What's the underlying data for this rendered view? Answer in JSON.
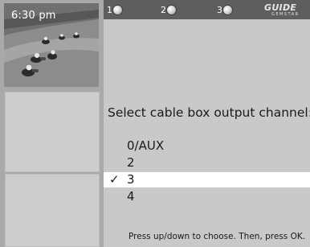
{
  "clock": {
    "time": "6:30 pm"
  },
  "tabs": [
    {
      "number": "1"
    },
    {
      "number": "2"
    },
    {
      "number": "3"
    }
  ],
  "logo": {
    "main": "GUIDE",
    "sub": "GEMSTAR"
  },
  "prompt": "Select cable box output channel:",
  "options": [
    {
      "label": "0/AUX",
      "selected": false
    },
    {
      "label": "2",
      "selected": false
    },
    {
      "label": "3",
      "selected": true,
      "check": "✓"
    },
    {
      "label": "4",
      "selected": false
    }
  ],
  "footer": "Press up/down to choose. Then, press OK.",
  "colors": {
    "topbar": "#5e5e5e",
    "panel": "#c9c9c9",
    "selected_row": "#ffffff",
    "sidebar": "#a9a9a9"
  }
}
